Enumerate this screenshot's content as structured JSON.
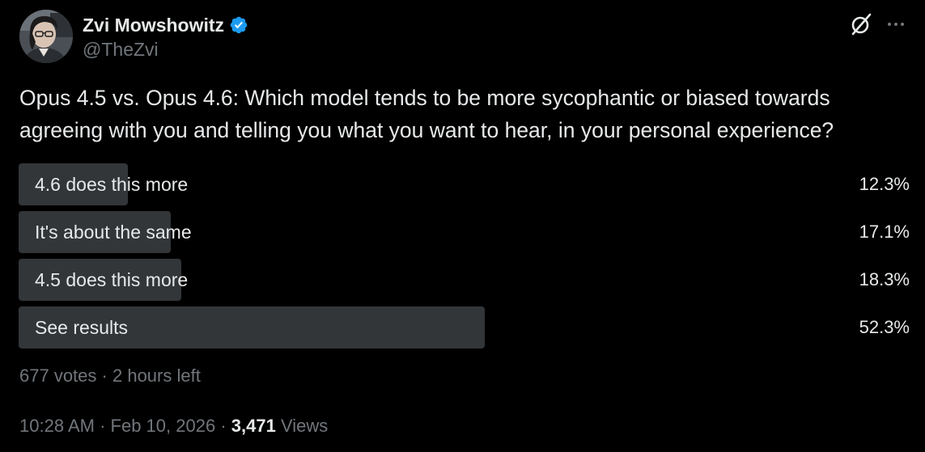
{
  "author": {
    "display_name": "Zvi Mowshowitz",
    "handle": "@TheZvi",
    "verified_badge_color": "#1d9bf0",
    "avatar_icon": "profile-photo"
  },
  "header_actions": {
    "grok_icon": "grok-icon",
    "more_icon": "more-horizontal-icon"
  },
  "tweet": {
    "text": "Opus 4.5 vs. Opus 4.6: Which model tends to be more sycophantic or biased towards agreeing with you and telling you what you want to hear, in your personal experience?"
  },
  "poll": {
    "options": [
      {
        "label": "4.6 does this more",
        "percent_text": "12.3%",
        "fraction": 0.123
      },
      {
        "label": "It's about the same",
        "percent_text": "17.1%",
        "fraction": 0.171
      },
      {
        "label": "4.5 does this more",
        "percent_text": "18.3%",
        "fraction": 0.183
      },
      {
        "label": "See results",
        "percent_text": "52.3%",
        "fraction": 0.523
      }
    ],
    "bar_color": "#333639",
    "votes": "677 votes",
    "separator": "·",
    "time_left": "2 hours left"
  },
  "meta": {
    "time": "10:28 AM",
    "separator": "·",
    "date": "Feb 10, 2026",
    "views_count": "3,471",
    "views_label": "Views"
  },
  "colors": {
    "background": "#000000",
    "text_primary": "#e7e9ea",
    "text_secondary": "#71767b"
  }
}
